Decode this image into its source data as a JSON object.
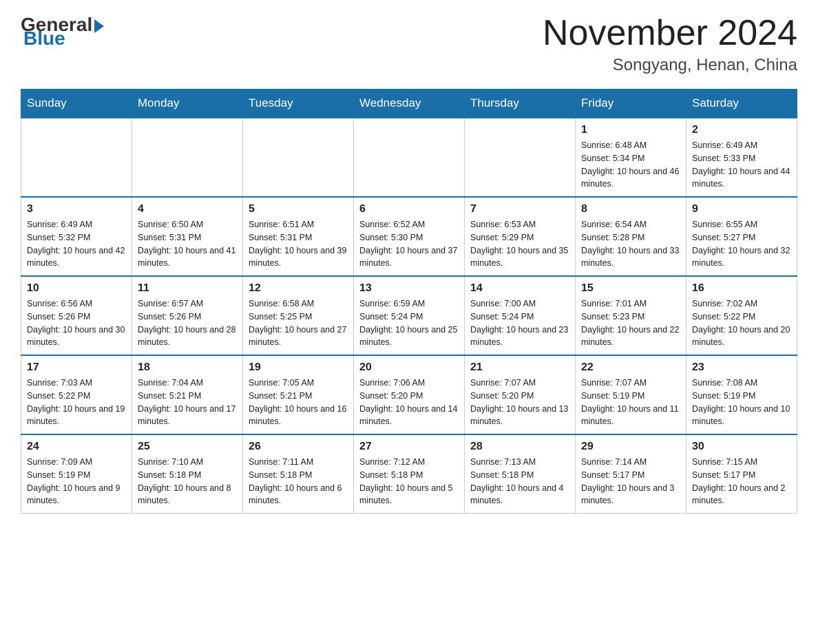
{
  "header": {
    "logo": {
      "general": "General",
      "blue": "Blue"
    },
    "title": "November 2024",
    "location": "Songyang, Henan, China"
  },
  "weekdays": [
    "Sunday",
    "Monday",
    "Tuesday",
    "Wednesday",
    "Thursday",
    "Friday",
    "Saturday"
  ],
  "weeks": [
    [
      {
        "day": "",
        "info": ""
      },
      {
        "day": "",
        "info": ""
      },
      {
        "day": "",
        "info": ""
      },
      {
        "day": "",
        "info": ""
      },
      {
        "day": "",
        "info": ""
      },
      {
        "day": "1",
        "info": "Sunrise: 6:48 AM\nSunset: 5:34 PM\nDaylight: 10 hours and 46 minutes."
      },
      {
        "day": "2",
        "info": "Sunrise: 6:49 AM\nSunset: 5:33 PM\nDaylight: 10 hours and 44 minutes."
      }
    ],
    [
      {
        "day": "3",
        "info": "Sunrise: 6:49 AM\nSunset: 5:32 PM\nDaylight: 10 hours and 42 minutes."
      },
      {
        "day": "4",
        "info": "Sunrise: 6:50 AM\nSunset: 5:31 PM\nDaylight: 10 hours and 41 minutes."
      },
      {
        "day": "5",
        "info": "Sunrise: 6:51 AM\nSunset: 5:31 PM\nDaylight: 10 hours and 39 minutes."
      },
      {
        "day": "6",
        "info": "Sunrise: 6:52 AM\nSunset: 5:30 PM\nDaylight: 10 hours and 37 minutes."
      },
      {
        "day": "7",
        "info": "Sunrise: 6:53 AM\nSunset: 5:29 PM\nDaylight: 10 hours and 35 minutes."
      },
      {
        "day": "8",
        "info": "Sunrise: 6:54 AM\nSunset: 5:28 PM\nDaylight: 10 hours and 33 minutes."
      },
      {
        "day": "9",
        "info": "Sunrise: 6:55 AM\nSunset: 5:27 PM\nDaylight: 10 hours and 32 minutes."
      }
    ],
    [
      {
        "day": "10",
        "info": "Sunrise: 6:56 AM\nSunset: 5:26 PM\nDaylight: 10 hours and 30 minutes."
      },
      {
        "day": "11",
        "info": "Sunrise: 6:57 AM\nSunset: 5:26 PM\nDaylight: 10 hours and 28 minutes."
      },
      {
        "day": "12",
        "info": "Sunrise: 6:58 AM\nSunset: 5:25 PM\nDaylight: 10 hours and 27 minutes."
      },
      {
        "day": "13",
        "info": "Sunrise: 6:59 AM\nSunset: 5:24 PM\nDaylight: 10 hours and 25 minutes."
      },
      {
        "day": "14",
        "info": "Sunrise: 7:00 AM\nSunset: 5:24 PM\nDaylight: 10 hours and 23 minutes."
      },
      {
        "day": "15",
        "info": "Sunrise: 7:01 AM\nSunset: 5:23 PM\nDaylight: 10 hours and 22 minutes."
      },
      {
        "day": "16",
        "info": "Sunrise: 7:02 AM\nSunset: 5:22 PM\nDaylight: 10 hours and 20 minutes."
      }
    ],
    [
      {
        "day": "17",
        "info": "Sunrise: 7:03 AM\nSunset: 5:22 PM\nDaylight: 10 hours and 19 minutes."
      },
      {
        "day": "18",
        "info": "Sunrise: 7:04 AM\nSunset: 5:21 PM\nDaylight: 10 hours and 17 minutes."
      },
      {
        "day": "19",
        "info": "Sunrise: 7:05 AM\nSunset: 5:21 PM\nDaylight: 10 hours and 16 minutes."
      },
      {
        "day": "20",
        "info": "Sunrise: 7:06 AM\nSunset: 5:20 PM\nDaylight: 10 hours and 14 minutes."
      },
      {
        "day": "21",
        "info": "Sunrise: 7:07 AM\nSunset: 5:20 PM\nDaylight: 10 hours and 13 minutes."
      },
      {
        "day": "22",
        "info": "Sunrise: 7:07 AM\nSunset: 5:19 PM\nDaylight: 10 hours and 11 minutes."
      },
      {
        "day": "23",
        "info": "Sunrise: 7:08 AM\nSunset: 5:19 PM\nDaylight: 10 hours and 10 minutes."
      }
    ],
    [
      {
        "day": "24",
        "info": "Sunrise: 7:09 AM\nSunset: 5:19 PM\nDaylight: 10 hours and 9 minutes."
      },
      {
        "day": "25",
        "info": "Sunrise: 7:10 AM\nSunset: 5:18 PM\nDaylight: 10 hours and 8 minutes."
      },
      {
        "day": "26",
        "info": "Sunrise: 7:11 AM\nSunset: 5:18 PM\nDaylight: 10 hours and 6 minutes."
      },
      {
        "day": "27",
        "info": "Sunrise: 7:12 AM\nSunset: 5:18 PM\nDaylight: 10 hours and 5 minutes."
      },
      {
        "day": "28",
        "info": "Sunrise: 7:13 AM\nSunset: 5:18 PM\nDaylight: 10 hours and 4 minutes."
      },
      {
        "day": "29",
        "info": "Sunrise: 7:14 AM\nSunset: 5:17 PM\nDaylight: 10 hours and 3 minutes."
      },
      {
        "day": "30",
        "info": "Sunrise: 7:15 AM\nSunset: 5:17 PM\nDaylight: 10 hours and 2 minutes."
      }
    ]
  ]
}
